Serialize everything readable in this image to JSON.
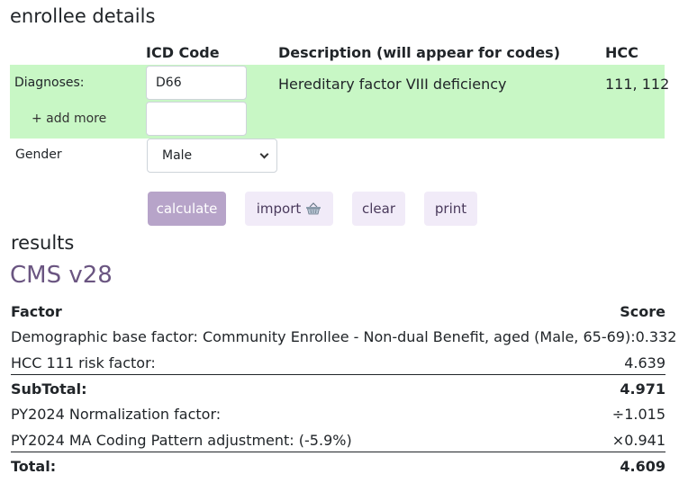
{
  "enrollee": {
    "heading": "enrollee details",
    "columns": {
      "icd": "ICD Code",
      "description": "Description (will appear for codes)",
      "hcc": "HCC"
    },
    "diagnoses_label": "Diagnoses:",
    "add_more_label": "+ add more",
    "icd_code_value": "D66",
    "icd_code_2_value": "",
    "description_value": "Hereditary factor VIII deficiency",
    "hcc_value": "111, 112",
    "gender_label": "Gender",
    "gender_selected": "Male"
  },
  "buttons": {
    "calculate": "calculate",
    "import": "import",
    "clear": "clear",
    "print": "print"
  },
  "results": {
    "heading": "results",
    "model": "CMS v28",
    "header_factor": "Factor",
    "header_score": "Score",
    "rows": [
      {
        "label": "Demographic base factor: Community Enrollee - Non-dual Benefit, aged (Male, 65-69):",
        "value": "0.332"
      },
      {
        "label": "HCC 111 risk factor:",
        "value": "4.639"
      }
    ],
    "subtotal_label": "SubTotal:",
    "subtotal_value": "4.971",
    "adjustments": [
      {
        "label": "PY2024 Normalization factor:",
        "value": "÷1.015"
      },
      {
        "label": "PY2024 MA Coding Pattern adjustment: (-5.9%)",
        "value": "×0.941"
      }
    ],
    "total_label": "Total:",
    "total_value": "4.609"
  },
  "colors": {
    "diagnosis_band": "#c8f7c5",
    "primary_button": "#b7a4c9",
    "light_button": "#f1ebf8",
    "model_title": "#6a5581"
  },
  "icons": {
    "import": "basket-icon",
    "gender_dropdown": "chevron-down-icon"
  }
}
